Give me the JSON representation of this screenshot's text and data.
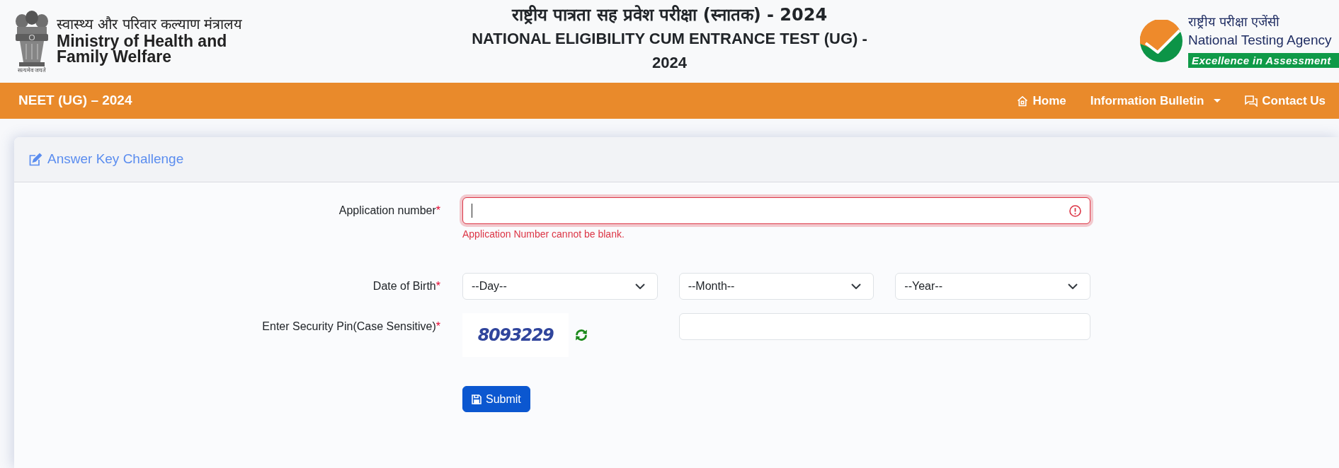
{
  "header": {
    "ministry": {
      "motto": "सत्यमेव जयते",
      "name_hindi": "स्वास्थ्य और परिवार कल्याण मंत्रालय",
      "name": "Ministry of Health and Family Welfare"
    },
    "title_hindi": "राष्ट्रीय पात्रता सह प्रवेश परीक्षा (स्नातक) - 2024",
    "title": "NATIONAL ELIGIBILITY CUM ENTRANCE TEST (UG) - 2024",
    "agency": {
      "name_hindi": "राष्ट्रीय परीक्षा एजेंसी",
      "name": "National Testing Agency",
      "tagline": "Excellence in Assessment"
    }
  },
  "navbar": {
    "brand": "NEET (UG) – 2024",
    "items": [
      {
        "label": "Home",
        "kind": "link"
      },
      {
        "label": "Information Bulletin",
        "kind": "dropdown"
      },
      {
        "label": "Contact Us",
        "kind": "link"
      }
    ]
  },
  "card": {
    "title": "Answer Key Challenge",
    "fields": [
      {
        "kind": "text",
        "label": "Application number",
        "required_mark": "*",
        "invalid": true,
        "focused": true,
        "error": "Application Number cannot be blank."
      },
      {
        "kind": "date",
        "label": "Date of Birth",
        "required_mark": "*",
        "selects": [
          {
            "value": "--Day--"
          },
          {
            "value": "--Month--"
          },
          {
            "value": "--Year--"
          }
        ]
      },
      {
        "kind": "captcha",
        "label": "Enter Security Pin(Case Sensitive)",
        "required_mark": "*",
        "captcha": "8093229"
      }
    ],
    "submit_button": {
      "label": "Submit"
    }
  }
}
